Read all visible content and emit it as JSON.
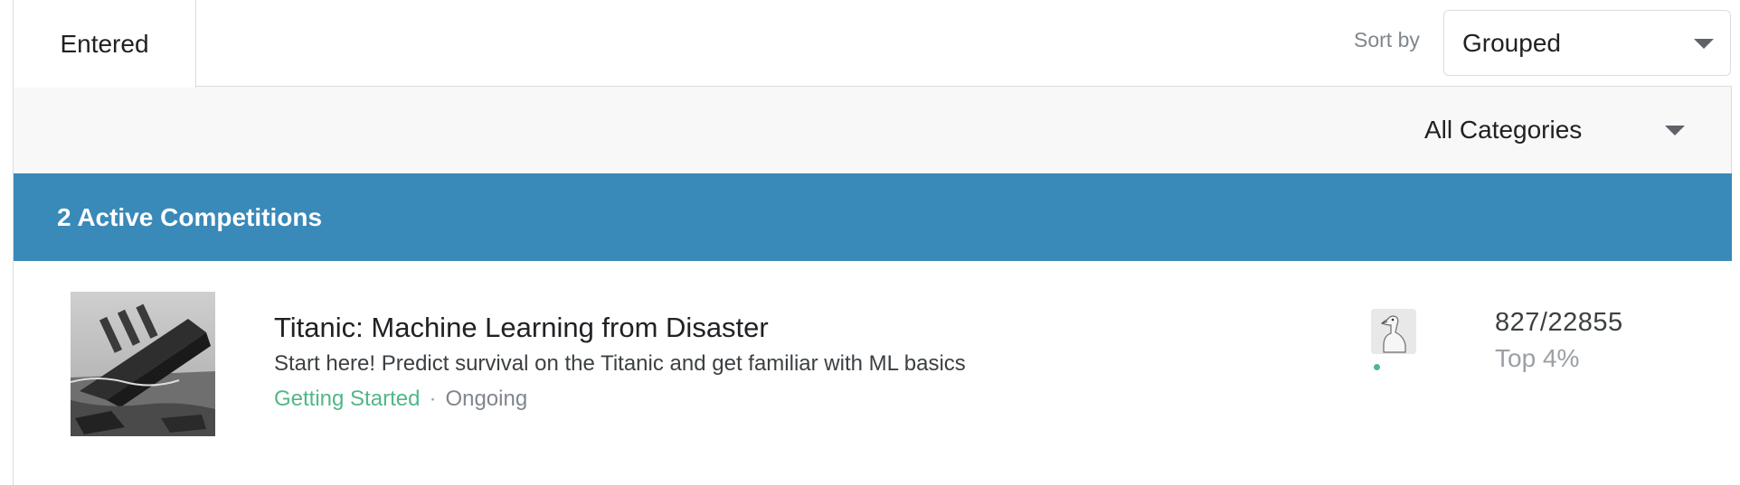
{
  "tabs": {
    "entered_label": "Entered"
  },
  "sort": {
    "label": "Sort by",
    "selected": "Grouped"
  },
  "filter": {
    "category_selected": "All Categories"
  },
  "section": {
    "header": "2 Active Competitions"
  },
  "competitions": [
    {
      "title": "Titanic: Machine Learning from Disaster",
      "description": "Start here! Predict survival on the Titanic and get familiar with ML basics",
      "category": "Getting Started",
      "separator": "·",
      "status": "Ongoing",
      "rank": "827/22855",
      "percentile": "Top 4%",
      "thumbnail_icon": "titanic-ship-image",
      "avatar_icon": "goose-avatar"
    }
  ],
  "colors": {
    "accent_blue": "#3989b9",
    "category_green": "#51b788",
    "filter_band_bg": "#f8f8f8"
  }
}
